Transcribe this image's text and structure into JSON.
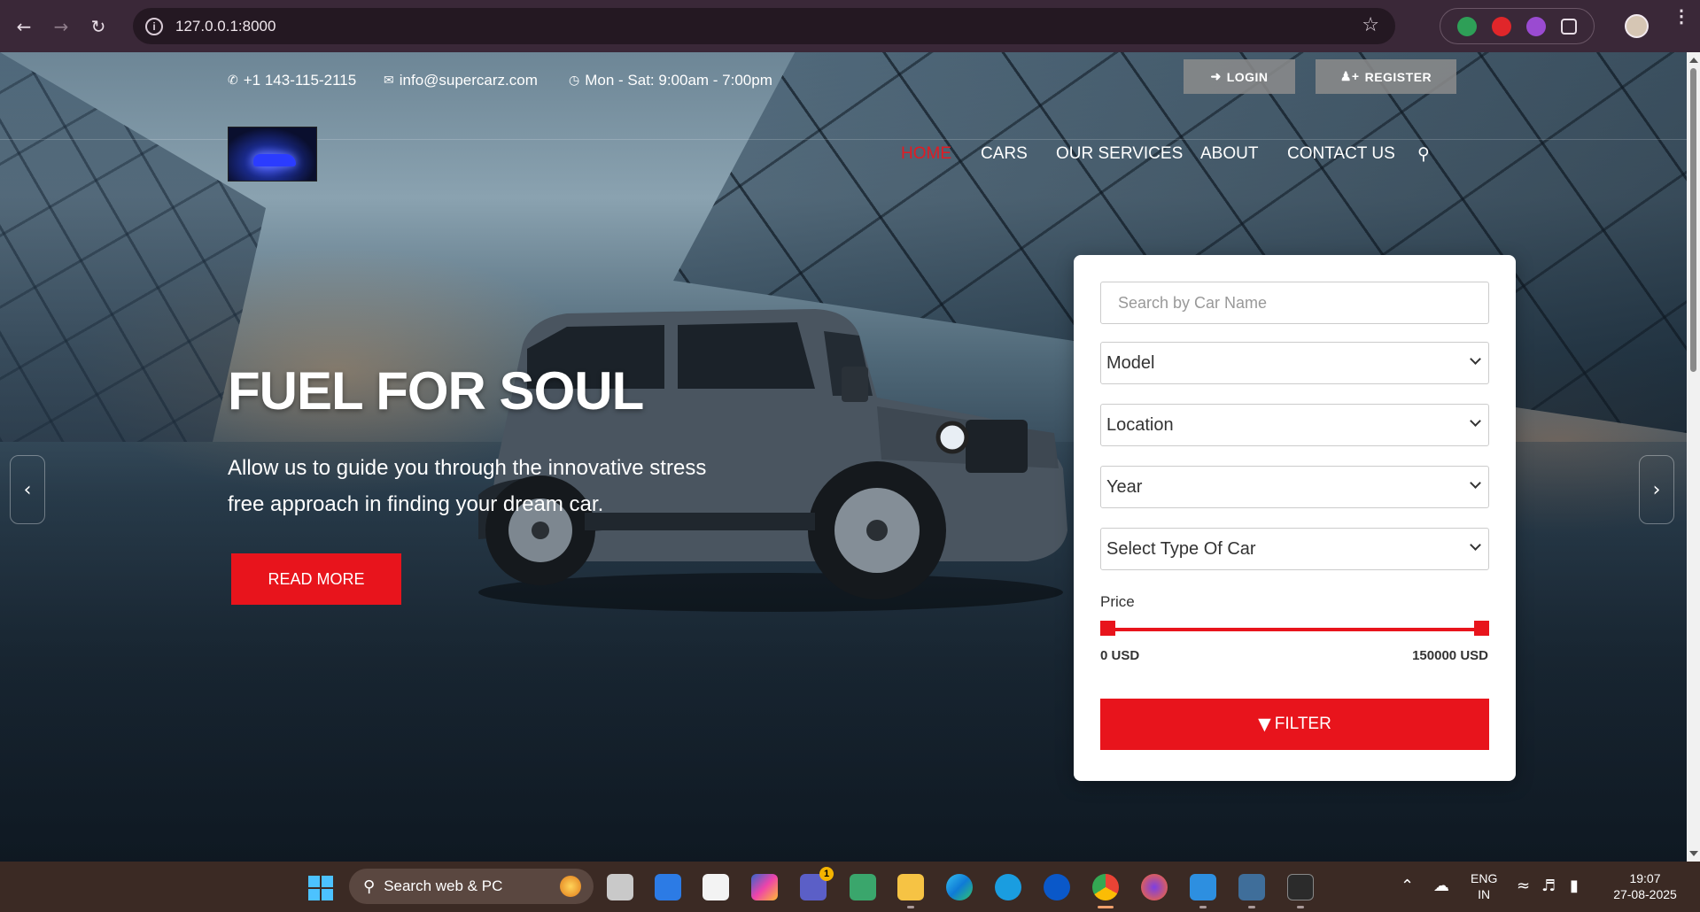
{
  "browser": {
    "url": "127.0.0.1:8000"
  },
  "topbar": {
    "phone": "+1 143-115-2115",
    "email": "info@supercarz.com",
    "hours": "Mon - Sat: 9:00am - 7:00pm",
    "login_label": "LOGIN",
    "register_label": "REGISTER"
  },
  "nav": {
    "items": [
      {
        "label": "HOME",
        "active": true
      },
      {
        "label": "CARS"
      },
      {
        "label": "OUR SERVICES"
      },
      {
        "label": "ABOUT"
      },
      {
        "label": "CONTACT US"
      }
    ],
    "search_icon": "search-icon"
  },
  "hero": {
    "title": "FUEL FOR SOUL",
    "subtitle": "Allow us to guide you through the innovative stress free approach in finding your dream car.",
    "button_label": "READ MORE"
  },
  "filter": {
    "search_placeholder": "Search by Car Name",
    "model_label": "Model",
    "location_label": "Location",
    "year_label": "Year",
    "type_label": "Select Type Of Car",
    "price_label": "Price",
    "price_min": "0 USD",
    "price_max": "150000 USD",
    "button_label": "FILTER"
  },
  "taskbar": {
    "search_label": "Search web & PC",
    "teams_badge": "1",
    "lang_line1": "ENG",
    "lang_line2": "IN",
    "time": "19:07",
    "date": "27-08-2025"
  },
  "colors": {
    "accent": "#e8141c",
    "chrome": "#3a2838",
    "taskbar": "#3b2a24"
  }
}
